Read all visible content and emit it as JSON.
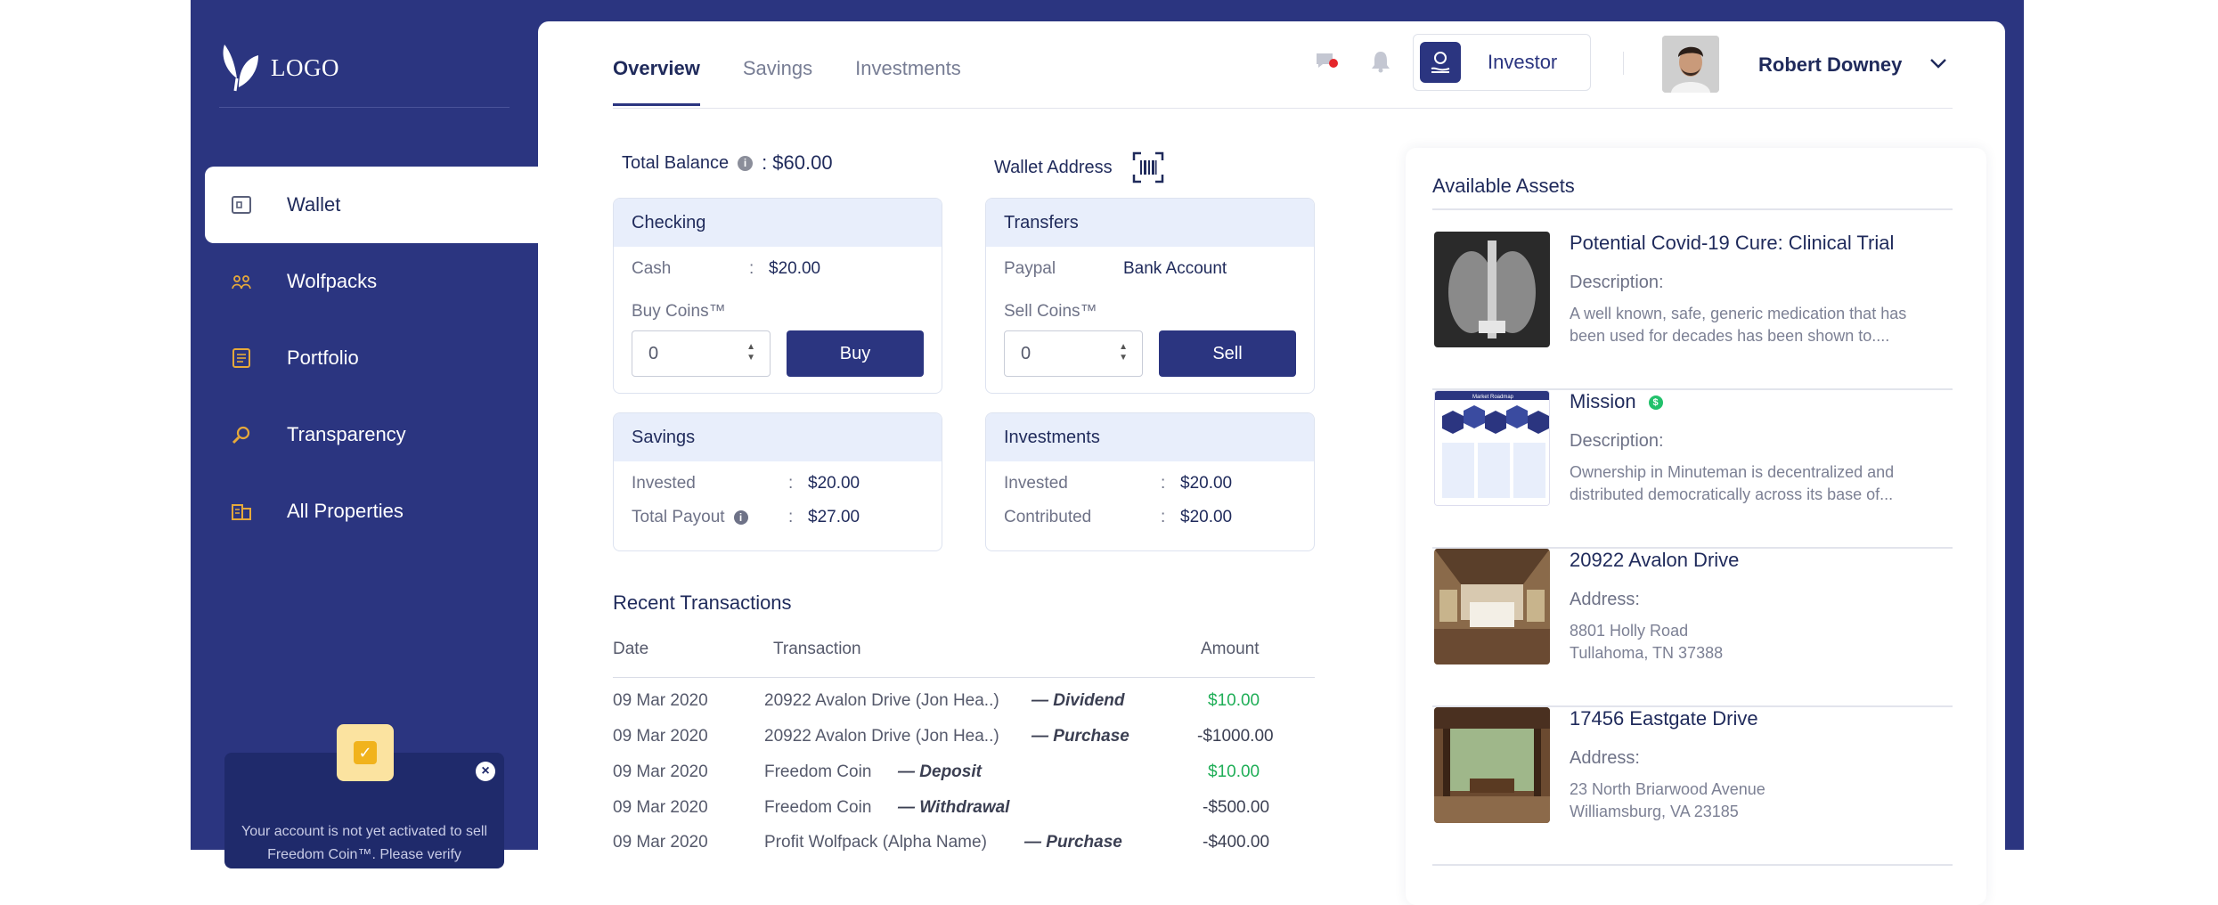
{
  "brand": {
    "logo_text": "LOGO"
  },
  "sidebar": {
    "items": [
      {
        "label": "Wallet",
        "icon": "wallet-icon"
      },
      {
        "label": "Wolfpacks",
        "icon": "wolfpack-icon"
      },
      {
        "label": "Portfolio",
        "icon": "portfolio-icon"
      },
      {
        "label": "Transparency",
        "icon": "magnifier-icon"
      },
      {
        "label": "All Properties",
        "icon": "buildings-icon"
      }
    ],
    "notice": {
      "message": "Your account is not yet activated to sell Freedom Coin™. Please verify"
    }
  },
  "header": {
    "tabs": [
      "Overview",
      "Savings",
      "Investments"
    ],
    "role": "Investor",
    "user_name": "Robert Downey"
  },
  "wallet": {
    "total_balance_label": "Total Balance",
    "total_balance_value": ": $60.00",
    "wallet_address_label": "Wallet Address"
  },
  "checking": {
    "title": "Checking",
    "cash_label": "Cash",
    "colon": ":",
    "cash_value": "$20.00",
    "buy_coins_label": "Buy Coins™",
    "quantity": "0",
    "buy_label": "Buy"
  },
  "transfers": {
    "title": "Transfers",
    "paypal": "Paypal",
    "bank": "Bank Account",
    "sell_coins_label": "Sell Coins™",
    "quantity": "0",
    "sell_label": "Sell"
  },
  "savings": {
    "title": "Savings",
    "invested_label": "Invested",
    "invested_value": "$20.00",
    "payout_label": "Total Payout",
    "payout_value": "$27.00"
  },
  "investments": {
    "title": "Investments",
    "invested_label": "Invested",
    "invested_value": "$20.00",
    "contributed_label": "Contributed",
    "contributed_value": "$20.00"
  },
  "transactions": {
    "title": "Recent Transactions",
    "headers": {
      "date": "Date",
      "transaction": "Transaction",
      "amount": "Amount"
    },
    "rows": [
      {
        "date": "09 Mar 2020",
        "desc": "20922 Avalon Drive  (Jon Hea..)",
        "kind": "— Dividend",
        "amount": "$10.00",
        "positive": true
      },
      {
        "date": "09 Mar 2020",
        "desc": "20922 Avalon Drive  (Jon Hea..)",
        "kind": "— Purchase",
        "amount": "-$1000.00",
        "positive": false
      },
      {
        "date": "09 Mar 2020",
        "desc": "Freedom Coin",
        "kind": "— Deposit",
        "amount": "$10.00",
        "positive": true
      },
      {
        "date": "09 Mar 2020",
        "desc": "Freedom Coin",
        "kind": "— Withdrawal",
        "amount": "-$500.00",
        "positive": false
      },
      {
        "date": "09 Mar 2020",
        "desc": "Profit Wolfpack (Alpha Name)",
        "kind": "— Purchase",
        "amount": "-$400.00",
        "positive": false
      }
    ]
  },
  "assets": {
    "title": "Available Assets",
    "items": [
      {
        "name": "Potential Covid-19 Cure: Clinical Trial",
        "label": "Description:",
        "line1": "A well known, safe, generic medication that has",
        "line2": "been used for decades has been shown to...."
      },
      {
        "name": "Mission",
        "label": "Description:",
        "line1": "Ownership in Minuteman is decentralized and",
        "line2": "distributed democratically across its base of..."
      },
      {
        "name": "20922 Avalon Drive",
        "label": "Address:",
        "line1": "8801 Holly Road",
        "line2": "Tullahoma, TN 37388"
      },
      {
        "name": "17456 Eastgate Drive",
        "label": "Address:",
        "line1": "23 North Briarwood Avenue",
        "line2": "Williamsburg, VA 23185"
      }
    ],
    "mission_badge": "$",
    "infographic_title": "Market Roadmap"
  },
  "colors": {
    "primary": "#2b3580",
    "accent": "#e6a93a",
    "positive": "#1fae57",
    "card_header": "#e8eefb"
  }
}
